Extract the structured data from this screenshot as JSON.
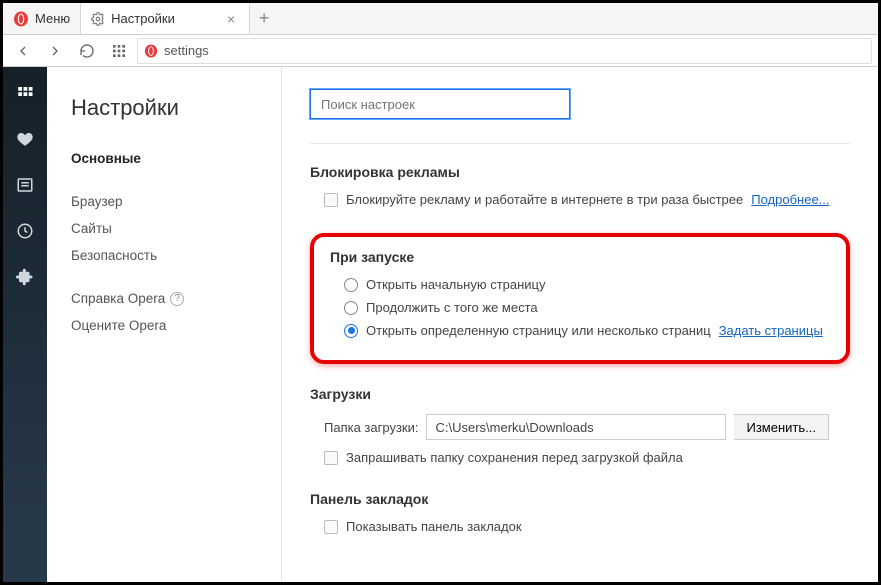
{
  "menu_label": "Меню",
  "tab_title": "Настройки",
  "address": "settings",
  "page_title": "Настройки",
  "nav": {
    "main": "Основные",
    "browser": "Браузер",
    "sites": "Сайты",
    "security": "Безопасность",
    "help": "Справка Opera",
    "rate": "Оцените Opera"
  },
  "search_placeholder": "Поиск настроек",
  "adblock": {
    "heading": "Блокировка рекламы",
    "checkbox": "Блокируйте рекламу и работайте в интернете в три раза быстрее",
    "more": "Подробнее..."
  },
  "startup": {
    "heading": "При запуске",
    "opt1": "Открыть начальную страницу",
    "opt2": "Продолжить с того же места",
    "opt3": "Открыть определенную страницу или несколько страниц",
    "set_pages": "Задать страницы"
  },
  "downloads": {
    "heading": "Загрузки",
    "label": "Папка загрузки:",
    "path": "C:\\Users\\merku\\Downloads",
    "change": "Изменить...",
    "ask": "Запрашивать папку сохранения перед загрузкой файла"
  },
  "bookmarks_bar": {
    "heading": "Панель закладок",
    "show": "Показывать панель закладок"
  }
}
